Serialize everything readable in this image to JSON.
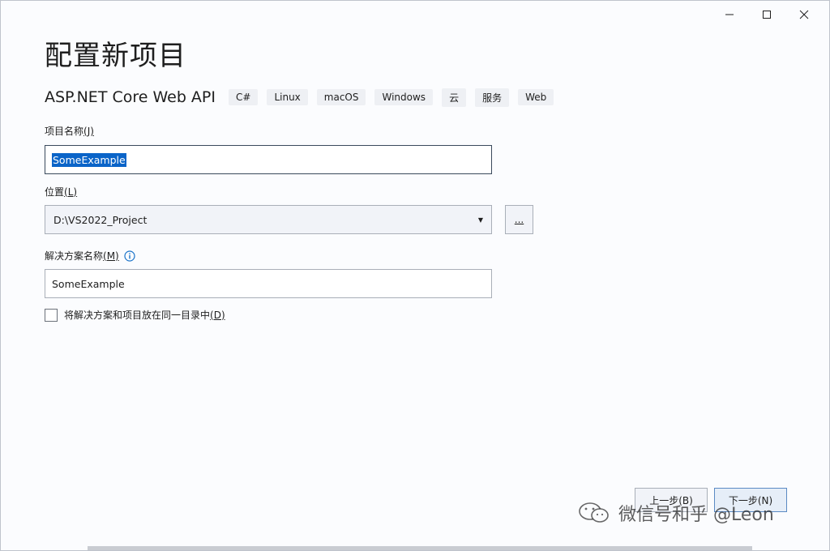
{
  "window": {
    "controls": [
      "minimize",
      "maximize",
      "close"
    ]
  },
  "page": {
    "title": "配置新项目"
  },
  "template": {
    "name": "ASP.NET Core Web API",
    "tags": [
      "C#",
      "Linux",
      "macOS",
      "Windows",
      "云",
      "服务",
      "Web"
    ]
  },
  "project_name": {
    "label": "项目名称",
    "accel": "(J)",
    "value": "SomeExample"
  },
  "location": {
    "label": "位置",
    "accel": "(L)",
    "value": "D:\\VS2022_Project",
    "browse_label": "..."
  },
  "solution_name": {
    "label": "解决方案名称",
    "accel": "(M)",
    "value": "SomeExample"
  },
  "same_dir": {
    "label": "将解决方案和项目放在同一目录中",
    "accel": "(D)",
    "checked": false
  },
  "footer": {
    "back_label": "上一步(B)",
    "next_label": "下一步(N)"
  },
  "watermark": {
    "text": "微信号和乎 @Leon"
  },
  "colors": {
    "selection": "#0a64c8",
    "info_icon": "#1a73c9"
  }
}
